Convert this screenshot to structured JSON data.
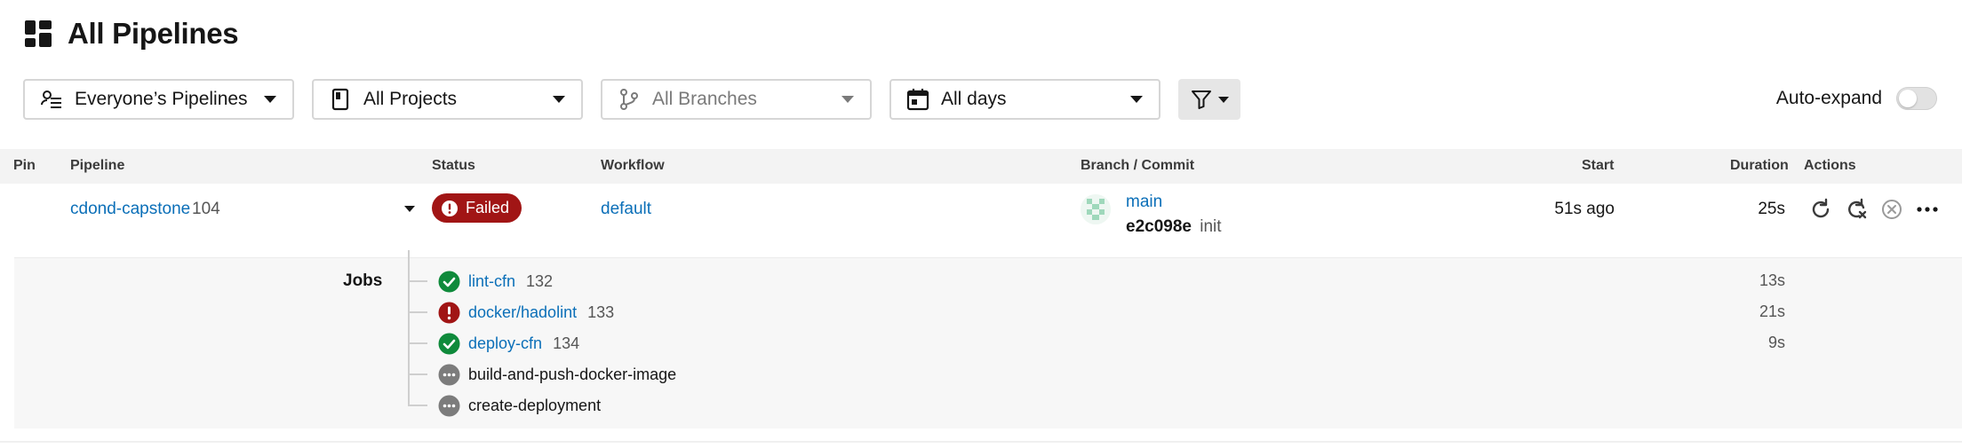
{
  "page": {
    "title": "All Pipelines"
  },
  "filters": {
    "owner": "Everyone’s Pipelines",
    "project": "All Projects",
    "branch": "All Branches",
    "date": "All days"
  },
  "auto_expand": {
    "label": "Auto-expand",
    "enabled": false
  },
  "table": {
    "headers": {
      "pin": "Pin",
      "pipeline": "Pipeline",
      "status": "Status",
      "workflow": "Workflow",
      "branch_commit": "Branch / Commit",
      "start": "Start",
      "duration": "Duration",
      "actions": "Actions"
    },
    "row": {
      "project": "cdond-capstone",
      "number": "104",
      "status": "Failed",
      "workflow": "default",
      "branch": "main",
      "commit_sha": "e2c098e",
      "commit_message": "init",
      "start": "51s ago",
      "duration": "25s"
    }
  },
  "jobs": {
    "label": "Jobs",
    "items": [
      {
        "name": "lint-cfn",
        "number": "132",
        "status": "success",
        "duration": "13s"
      },
      {
        "name": "docker/hadolint",
        "number": "133",
        "status": "failed",
        "duration": "21s"
      },
      {
        "name": "deploy-cfn",
        "number": "134",
        "status": "success",
        "duration": "9s"
      },
      {
        "name": "build-and-push-docker-image",
        "number": "",
        "status": "not-run",
        "duration": ""
      },
      {
        "name": "create-deployment",
        "number": "",
        "status": "not-run",
        "duration": ""
      }
    ]
  },
  "colors": {
    "link": "#0b6fb8",
    "failed": "#a11515",
    "success": "#0f8a3b",
    "not_run": "#7c7c7c"
  }
}
